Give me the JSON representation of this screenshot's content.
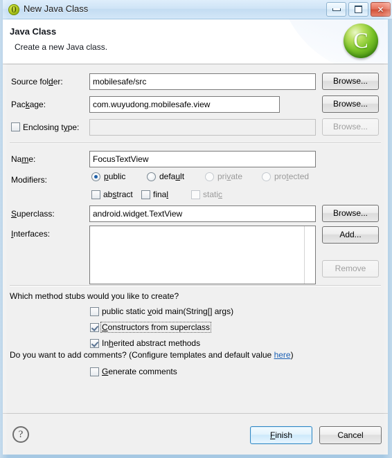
{
  "window": {
    "title": "New Java Class",
    "title_icon": "java-project-icon",
    "minimize_label": "Minimize",
    "maximize_label": "Maximize",
    "close_label": "Close"
  },
  "banner": {
    "title": "Java Class",
    "subtitle": "Create a new Java class.",
    "icon": "java-class-green-c-icon"
  },
  "form": {
    "source_folder": {
      "label": "Source folder:",
      "value": "mobilesafe/src",
      "browse_label": "Browse..."
    },
    "package": {
      "label": "Package:",
      "value": "com.wuyudong.mobilesafe.view",
      "browse_label": "Browse..."
    },
    "enclosing_type": {
      "label": "Enclosing type:",
      "value": "",
      "checked": false,
      "browse_label": "Browse..."
    },
    "name": {
      "label": "Name:",
      "value": "FocusTextView"
    },
    "modifiers": {
      "label": "Modifiers:",
      "access": [
        {
          "label": "public",
          "selected": true,
          "enabled": true
        },
        {
          "label": "default",
          "selected": false,
          "enabled": true
        },
        {
          "label": "private",
          "selected": false,
          "enabled": false
        },
        {
          "label": "protected",
          "selected": false,
          "enabled": false
        }
      ],
      "flags": [
        {
          "label": "abstract",
          "checked": false,
          "enabled": true
        },
        {
          "label": "final",
          "checked": false,
          "enabled": true
        },
        {
          "label": "static",
          "checked": false,
          "enabled": false
        }
      ]
    },
    "superclass": {
      "label": "Superclass:",
      "value": "android.widget.TextView",
      "browse_label": "Browse..."
    },
    "interfaces": {
      "label": "Interfaces:",
      "items": [],
      "add_label": "Add...",
      "remove_label": "Remove"
    }
  },
  "stubs": {
    "question": "Which method stubs would you like to create?",
    "options": [
      {
        "label": "public static void main(String[] args)",
        "checked": false,
        "focused": false
      },
      {
        "label": "Constructors from superclass",
        "checked": true,
        "focused": true
      },
      {
        "label": "Inherited abstract methods",
        "checked": true,
        "focused": false
      }
    ]
  },
  "comments": {
    "question_before": "Do you want to add comments? (Configure templates and default value ",
    "link": "here",
    "question_after": ")",
    "generate": {
      "label": "Generate comments",
      "checked": false
    }
  },
  "footer": {
    "help_label": "?",
    "finish_label": "Finish",
    "cancel_label": "Cancel"
  }
}
